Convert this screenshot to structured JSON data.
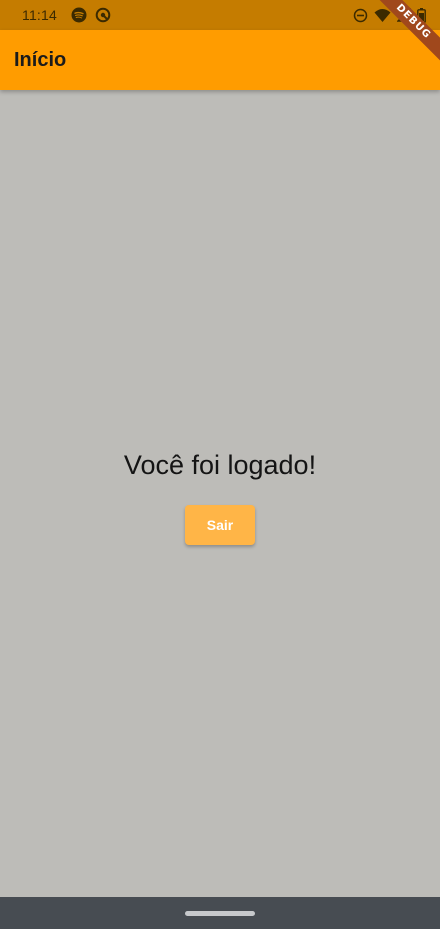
{
  "status_bar": {
    "time": "11:14",
    "left_icons": [
      "spotify-icon",
      "data-saver-icon"
    ],
    "right_icons": [
      "do-not-disturb-icon",
      "wifi-icon",
      "signal-icon",
      "battery-icon"
    ]
  },
  "debug_banner": {
    "label": "DEBUG"
  },
  "app_bar": {
    "title": "Início"
  },
  "main": {
    "message": "Você foi logado!",
    "logout_button_label": "Sair"
  },
  "colors": {
    "status_bar": "#c57c00",
    "app_bar": "#ff9c00",
    "background": "#bdbcb8",
    "button": "#ffb547",
    "nav_bar": "#474c52",
    "debug_ribbon": "#a0481c"
  }
}
